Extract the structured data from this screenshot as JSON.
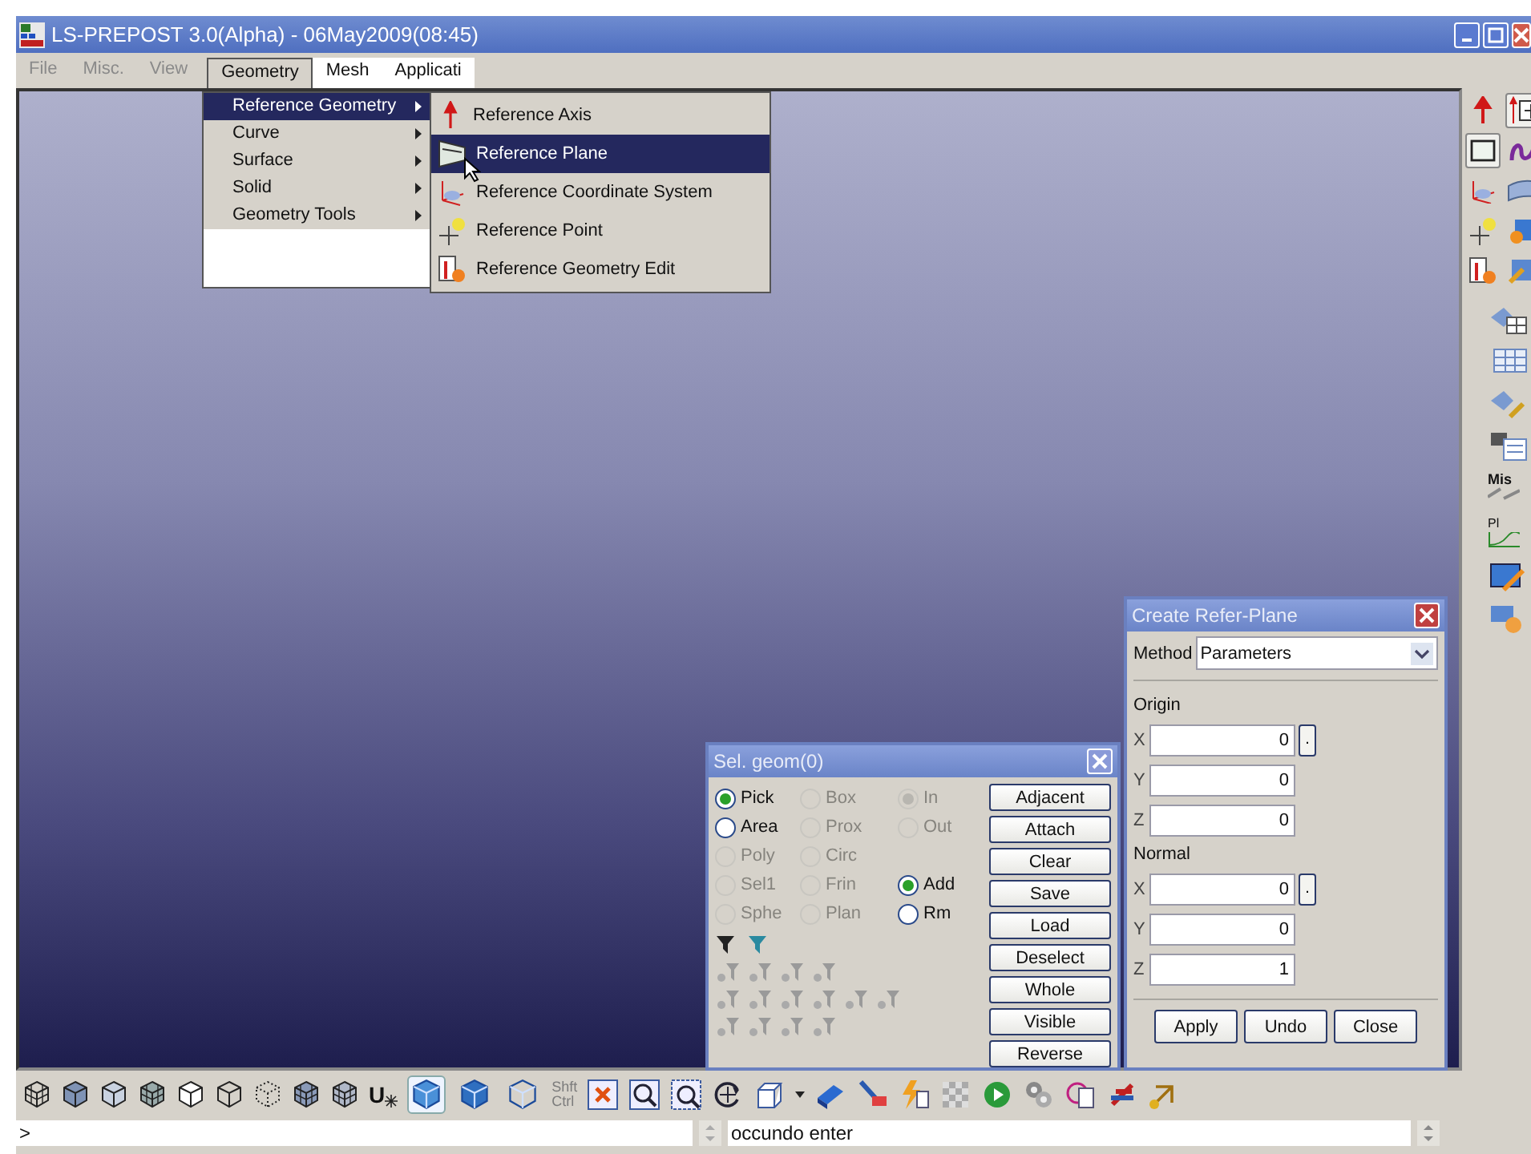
{
  "window": {
    "title": "LS-PREPOST 3.0(Alpha) - 06May2009(08:45)"
  },
  "menu_bar": [
    {
      "label": "File",
      "disabled": true,
      "selected": false
    },
    {
      "label": "Misc.",
      "disabled": true,
      "selected": false
    },
    {
      "label": "View",
      "disabled": true,
      "selected": false
    },
    {
      "label": "Geometry",
      "disabled": false,
      "selected": true
    },
    {
      "label": "Mesh",
      "disabled": false,
      "selected": false
    },
    {
      "label": "Applicati",
      "disabled": false,
      "selected": false
    }
  ],
  "geometry_menu": [
    {
      "label": "Reference Geometry",
      "selected": true
    },
    {
      "label": "Curve",
      "selected": false
    },
    {
      "label": "Surface",
      "selected": false
    },
    {
      "label": "Solid",
      "selected": false
    },
    {
      "label": "Geometry Tools",
      "selected": false
    }
  ],
  "reference_submenu": [
    {
      "label": "Reference Axis",
      "kind": "axis",
      "selected": false
    },
    {
      "label": "Reference Plane",
      "kind": "plane",
      "selected": true
    },
    {
      "label": "Reference Coordinate System",
      "kind": "coordinate",
      "selected": false
    },
    {
      "label": "Reference Point",
      "kind": "point",
      "selected": false
    },
    {
      "label": "Reference Geometry Edit",
      "kind": "edit",
      "selected": false
    }
  ],
  "right_toolbar": {
    "captions": [
      "Mis",
      "Pl"
    ]
  },
  "sel_geom": {
    "title": "Sel. geom(0)",
    "columns": [
      [
        {
          "label": "Pick",
          "selected": true,
          "disabled": false
        },
        {
          "label": "Area",
          "selected": false,
          "disabled": false
        },
        {
          "label": "Poly",
          "selected": false,
          "disabled": true
        },
        {
          "label": "Sel1",
          "selected": false,
          "disabled": true
        },
        {
          "label": "Sphe",
          "selected": false,
          "disabled": true
        }
      ],
      [
        {
          "label": "Box",
          "selected": false,
          "disabled": true
        },
        {
          "label": "Prox",
          "selected": false,
          "disabled": true
        },
        {
          "label": "Circ",
          "selected": false,
          "disabled": true
        },
        {
          "label": "Frin",
          "selected": false,
          "disabled": true
        },
        {
          "label": "Plan",
          "selected": false,
          "disabled": true
        }
      ]
    ],
    "scope": [
      {
        "label": "In",
        "selected": true,
        "disabled": true
      },
      {
        "label": "Out",
        "selected": false,
        "disabled": true
      }
    ],
    "action": [
      {
        "label": "Add",
        "selected": true,
        "disabled": false
      },
      {
        "label": "Rm",
        "selected": false,
        "disabled": false
      }
    ],
    "buttons": [
      "Adjacent",
      "Attach",
      "Clear",
      "Save",
      "Load",
      "Deselect",
      "Whole",
      "Visible",
      "Reverse"
    ]
  },
  "refer_plane": {
    "title": "Create Refer-Plane",
    "method_label": "Method",
    "method": "Parameters",
    "groups": [
      {
        "title": "Origin",
        "fields": [
          {
            "axis": "X",
            "value": "0",
            "pick": "."
          },
          {
            "axis": "Y",
            "value": "0"
          },
          {
            "axis": "Z",
            "value": "0"
          }
        ]
      },
      {
        "title": "Normal",
        "fields": [
          {
            "axis": "X",
            "value": "0",
            "pick": "."
          },
          {
            "axis": "Y",
            "value": "0"
          },
          {
            "axis": "Z",
            "value": "1"
          }
        ]
      }
    ],
    "buttons": [
      "Apply",
      "Undo",
      "Close"
    ]
  },
  "bottom_toolbar": {
    "u_label": "U",
    "modifier_keys": [
      "Shft",
      "Ctrl"
    ],
    "render_modes": [
      {
        "selected": true
      },
      {
        "selected": false
      },
      {
        "selected": false
      }
    ]
  },
  "command_line": {
    "prompt": ">",
    "message": "occundo enter"
  }
}
